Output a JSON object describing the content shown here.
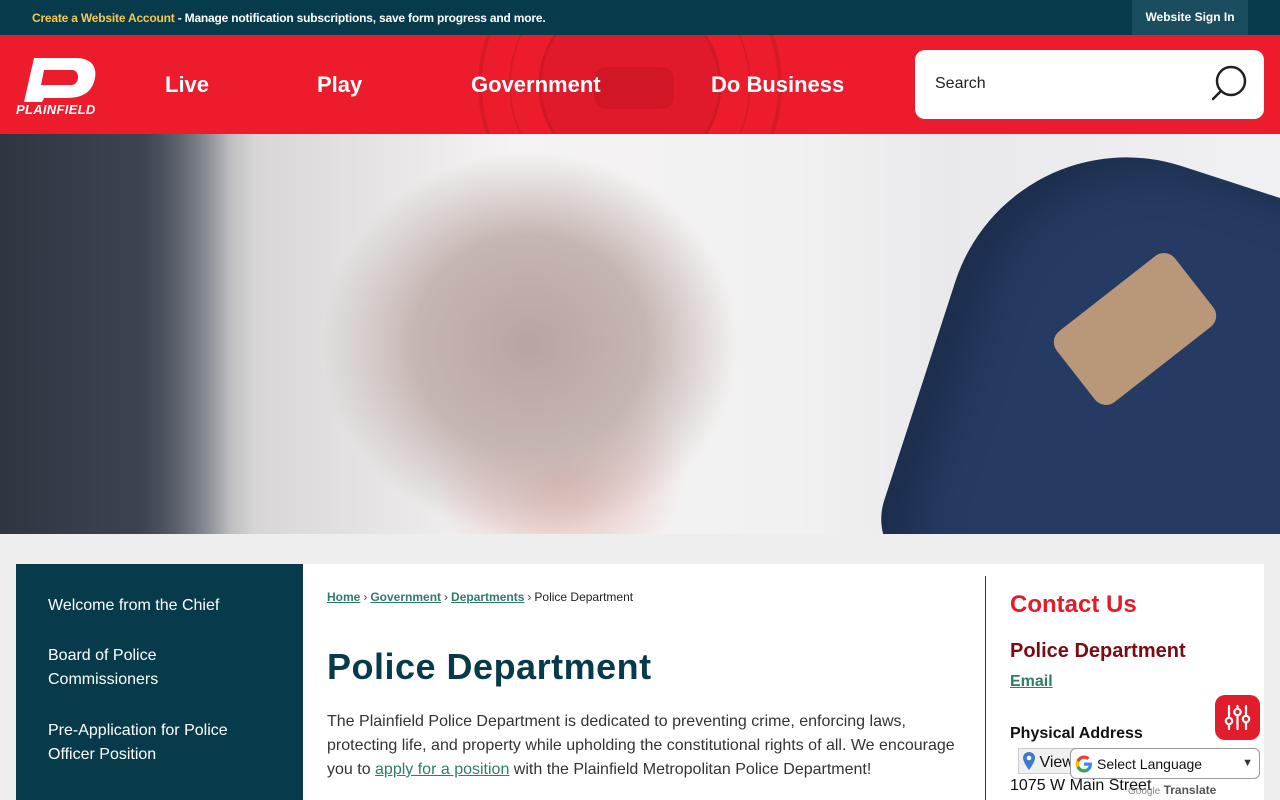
{
  "topbar": {
    "create_account": "Create a Website Account",
    "message": " - Manage notification subscriptions, save form progress and more.",
    "sign_in": "Website Sign In"
  },
  "header": {
    "logo_text": "PLAINFIELD",
    "nav": [
      "Live",
      "Play",
      "Government",
      "Do Business"
    ],
    "search_placeholder": "Search"
  },
  "sidebar": {
    "items": [
      "Welcome from the Chief",
      "Board of Police Commissioners",
      "Pre-Application for Police Officer Position"
    ]
  },
  "breadcrumb": {
    "home": "Home",
    "government": "Government",
    "departments": "Departments",
    "current": "Police Department",
    "separator": "›"
  },
  "main": {
    "title": "Police Department",
    "intro_before": "The Plainfield Police Department is dedicated to preventing crime, enforcing laws, protecting life, and property while upholding the constitutional rights of all. We encourage you to ",
    "intro_link": "apply for a position",
    "intro_after": " with the Plainfield Metropolitan Police Department!"
  },
  "contact": {
    "title": "Contact Us",
    "department": "Police Department",
    "email": "Email",
    "physical_label": "Physical Address",
    "view_map": "View",
    "address_line1": "1075 W Main Street"
  },
  "translate": {
    "select_label": "Select Language",
    "powered_brand": "Google",
    "powered_text": "Translate"
  },
  "colors": {
    "brand_red": "#ec1c2c",
    "navy": "#073b4c",
    "link_green": "#2e7d6b",
    "dept_maroon": "#7a0b14"
  }
}
